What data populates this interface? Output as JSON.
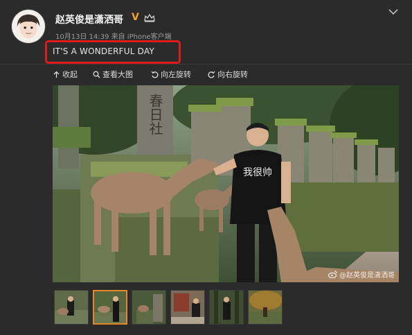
{
  "post": {
    "username": "赵英俊是潇洒哥",
    "verified_badge": "V",
    "meta": "10月13日 14:39 来自 iPhone客户端",
    "text": "IT'S A WONDERFUL DAY",
    "icons": {
      "crown": "crown-icon",
      "more": "chevron-down-icon"
    }
  },
  "toolbar": {
    "collapse": "收起",
    "view_large": "查看大图",
    "rotate_left": "向左旋转",
    "rotate_right": "向右旋转"
  },
  "photo": {
    "sign_text": "春日社",
    "shirt_text": "我很帅",
    "watermark": "@赵英俊是潇洒哥"
  },
  "thumbnails": {
    "count": 6,
    "active_index": 1
  },
  "colors": {
    "background": "#2b2b2b",
    "highlight": "#e01b1b",
    "verified": "#f5a623",
    "active_thumb": "#e8862a"
  }
}
